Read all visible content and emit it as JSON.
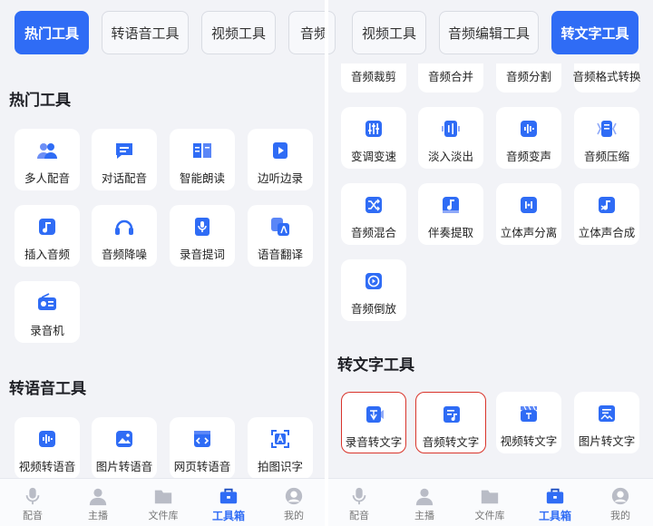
{
  "left": {
    "tabs": [
      "热门工具",
      "转语音工具",
      "视频工具",
      "音频"
    ],
    "sections": {
      "hot": {
        "title": "热门工具",
        "items": [
          "多人配音",
          "对话配音",
          "智能朗读",
          "边听边录",
          "插入音频",
          "音频降噪",
          "录音提词",
          "语音翻译",
          "录音机"
        ]
      },
      "tts": {
        "title": "转语音工具",
        "items": [
          "视频转语音",
          "图片转语音",
          "网页转语音",
          "拍图识字"
        ]
      }
    }
  },
  "right": {
    "tabs": [
      "视频工具",
      "音频编辑工具",
      "转文字工具"
    ],
    "audio_edit_items": [
      "音频裁剪",
      "音频合并",
      "音频分割",
      "音频格式转换",
      "变调变速",
      "淡入淡出",
      "音频变声",
      "音频压缩",
      "音频混合",
      "伴奏提取",
      "立体声分离",
      "立体声合成",
      "音频倒放"
    ],
    "stt": {
      "title": "转文字工具",
      "items": [
        "录音转文字",
        "音频转文字",
        "视频转文字",
        "图片转文字"
      ]
    }
  },
  "nav": [
    "配音",
    "主播",
    "文件库",
    "工具箱",
    "我的"
  ],
  "colors": {
    "accent": "#2f6cf5",
    "highlight_border": "#d9342b",
    "background": "#f2f3f7"
  }
}
